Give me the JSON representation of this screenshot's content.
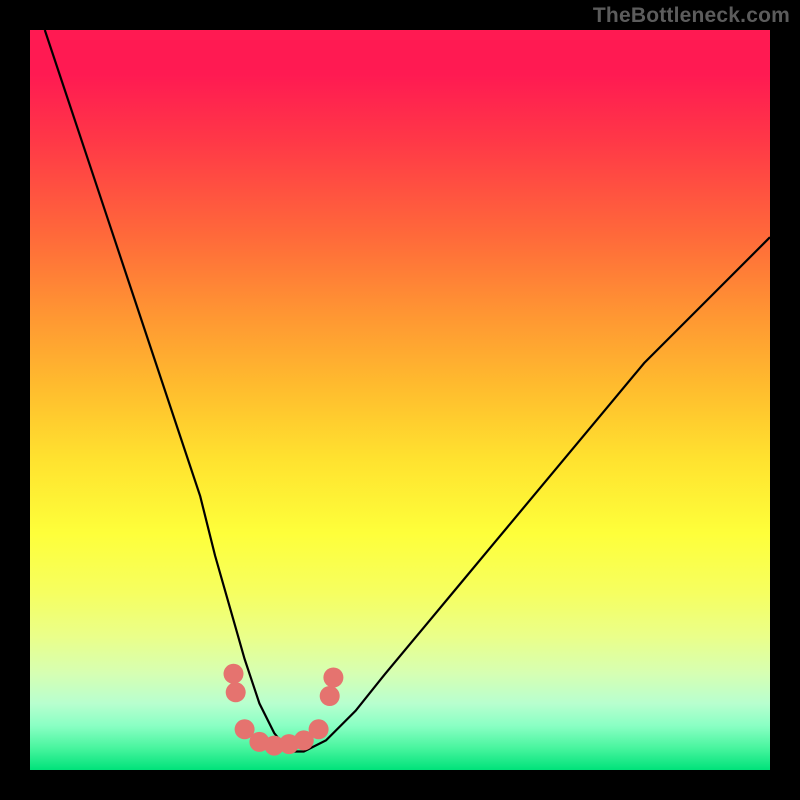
{
  "watermark": "TheBottleneck.com",
  "chart_data": {
    "type": "line",
    "title": "",
    "xlabel": "",
    "ylabel": "",
    "xlim": [
      0,
      100
    ],
    "ylim": [
      0,
      100
    ],
    "grid": false,
    "legend": false,
    "series": [
      {
        "name": "bottleneck-curve",
        "x": [
          2,
          5,
          8,
          11,
          14,
          17,
          20,
          23,
          25,
          27,
          29,
          31,
          33,
          35,
          37,
          40,
          44,
          48,
          53,
          58,
          63,
          68,
          73,
          78,
          83,
          88,
          93,
          98,
          100
        ],
        "y": [
          100,
          91,
          82,
          73,
          64,
          55,
          46,
          37,
          29,
          22,
          15,
          9,
          5,
          2.5,
          2.5,
          4,
          8,
          13,
          19,
          25,
          31,
          37,
          43,
          49,
          55,
          60,
          65,
          70,
          72
        ]
      }
    ],
    "markers": [
      {
        "x": 27.5,
        "y": 13.0
      },
      {
        "x": 27.8,
        "y": 10.5
      },
      {
        "x": 40.5,
        "y": 10.0
      },
      {
        "x": 41.0,
        "y": 12.5
      },
      {
        "x": 29.0,
        "y": 5.5
      },
      {
        "x": 31.0,
        "y": 3.8
      },
      {
        "x": 33.0,
        "y": 3.3
      },
      {
        "x": 35.0,
        "y": 3.5
      },
      {
        "x": 37.0,
        "y": 4.0
      },
      {
        "x": 39.0,
        "y": 5.5
      }
    ],
    "background_gradient_stops": [
      {
        "pct": 0,
        "color": "#ff1a52"
      },
      {
        "pct": 15,
        "color": "#ff3847"
      },
      {
        "pct": 38,
        "color": "#ff9433"
      },
      {
        "pct": 58,
        "color": "#ffe22f"
      },
      {
        "pct": 76,
        "color": "#f6ff60"
      },
      {
        "pct": 91,
        "color": "#b8ffcf"
      },
      {
        "pct": 100,
        "color": "#00e27a"
      }
    ]
  }
}
